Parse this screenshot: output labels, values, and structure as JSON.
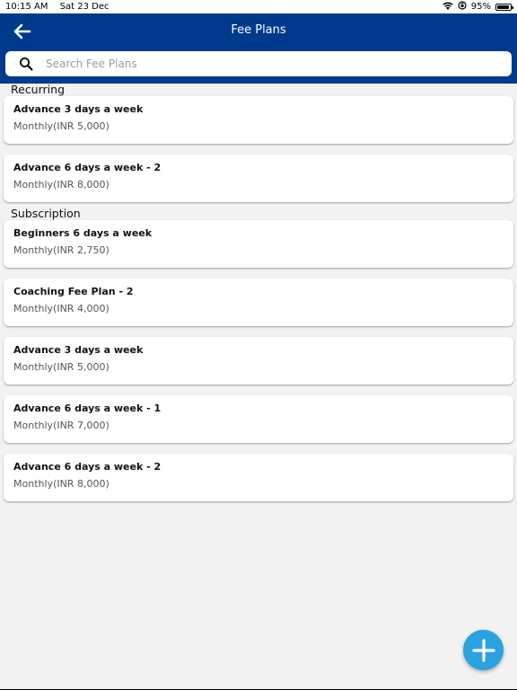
{
  "status_bar": {
    "time": "10:15 AM",
    "date": "Sat 23 Dec",
    "battery": "95%",
    "battery_level": 0.95
  },
  "header": {
    "title": "Fee Plans"
  },
  "search": {
    "placeholder": "Search Fee Plans",
    "value": ""
  },
  "sections": [
    {
      "title": "Recurring",
      "plans": [
        {
          "name": "Advance 3 days a week",
          "billing": "Monthly(INR 5,000)"
        },
        {
          "name": "Advance 6 days a week - 2",
          "billing": "Monthly(INR 8,000)"
        }
      ]
    },
    {
      "title": "Subscription",
      "plans": [
        {
          "name": "Beginners 6 days a week",
          "billing": "Monthly(INR 2,750)"
        },
        {
          "name": "Coaching Fee Plan - 2",
          "billing": "Monthly(INR 4,000)"
        },
        {
          "name": "Advance 3 days a week",
          "billing": "Monthly(INR 5,000)"
        },
        {
          "name": "Advance 6 days a week - 1",
          "billing": "Monthly(INR 7,000)"
        },
        {
          "name": "Advance 6 days a week - 2",
          "billing": "Monthly(INR 8,000)"
        }
      ]
    }
  ],
  "icons": {
    "back": "arrow-left-icon",
    "search": "search-icon",
    "add": "plus-icon",
    "wifi": "wifi-icon",
    "battery": "battery-icon"
  },
  "colors": {
    "header_bg": "#003a8c",
    "fab_bg": "#2aa2e0",
    "page_bg": "#f2f2f2"
  }
}
